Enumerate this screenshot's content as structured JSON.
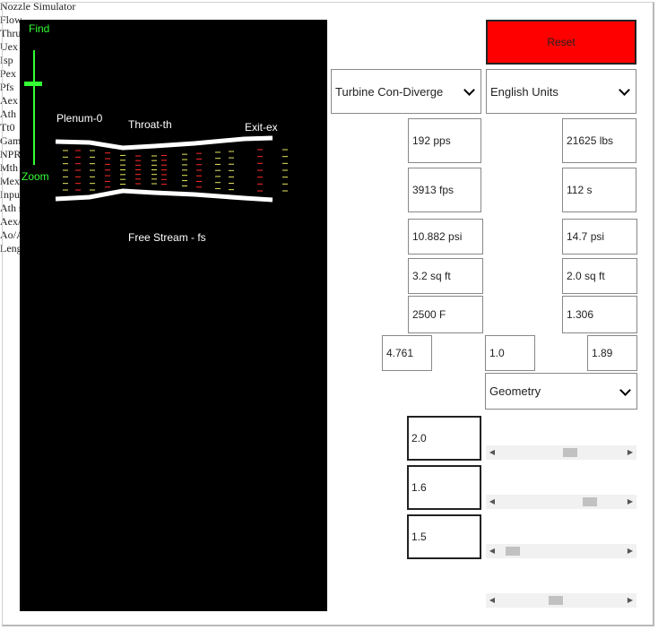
{
  "viewer": {
    "find_label": "Find",
    "zoom_label": "Zoom",
    "plenum_label": "Plenum-0",
    "throat_label": "Throat-th",
    "exit_label": "Exit-ex",
    "freestream_label": "Free Stream - fs"
  },
  "header": {
    "title": "Nozzle Simulator",
    "reset_label": "Reset"
  },
  "selectors": {
    "nozzle_type": "Turbine Con-Diverge",
    "units": "English Units",
    "input_panel_label": "Input Panel:",
    "input_panel": "Geometry"
  },
  "outputs": {
    "flow_label": "Flow",
    "flow": "192 pps",
    "thrust_label": "Thrust",
    "thrust": "21625 lbs",
    "uex_label": "Uex",
    "uex": "3913 fps",
    "isp_label": "Isp",
    "isp": "112 s",
    "pex_label": "Pex",
    "pex": "10.882 psi",
    "pfs_label": "Pfs",
    "pfs": "14.7 psi",
    "aex_label": "Aex",
    "aex": "3.2 sq ft",
    "ath_label": "Ath",
    "ath": "2.0 sq ft",
    "tt0_label": "Tt0",
    "tt0": "2500 F",
    "gamma_label": "Gamma",
    "gamma": "1.306",
    "npr_label": "NPR",
    "npr": "4.761",
    "mth_label": "Mth",
    "mth": "1.0",
    "mex_label": "Mex",
    "mex": "1.89"
  },
  "inputs": {
    "ath_label": "Ath sq ft",
    "ath": "2.0",
    "ath_slider": 0.58,
    "aexath_label": "Aex/Ath",
    "aexath": "1.6",
    "aexath_slider": 0.77,
    "aoath_label": "Ao/Ath",
    "aoath": "1.5",
    "aoath_slider": 0.05,
    "length_label": "Length",
    "length_slider": 0.45
  },
  "colors": {
    "reset": "#ff0000",
    "wall": "#ffffff",
    "zoom": "#33ff33",
    "flow_red": "#ff2a2a",
    "flow_yellow": "#e8e860"
  },
  "icons": {
    "dropdown": "chevron-down-icon",
    "scroll_left": "left-arrow-icon",
    "scroll_right": "right-arrow-icon"
  }
}
